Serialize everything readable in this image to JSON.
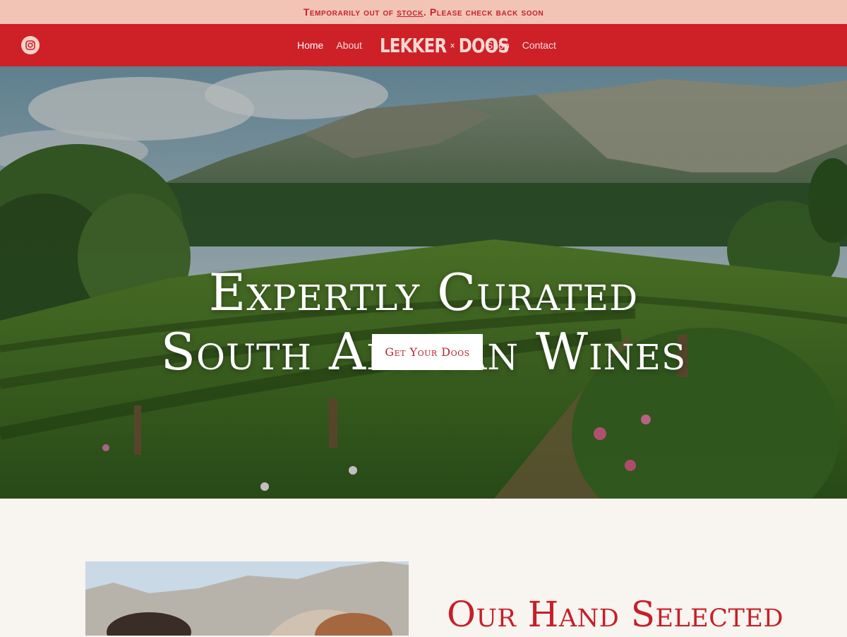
{
  "announcement": {
    "before_link": "Temporarily out of ",
    "link": "stock",
    "after_link": ". Please check back soon"
  },
  "header": {
    "social_icon": "instagram-icon",
    "nav_left": [
      "Home",
      "About"
    ],
    "nav_right": [
      "Shop",
      "Contact"
    ],
    "active": "Home",
    "logo_left": "LEKKER",
    "logo_sep": "×",
    "logo_right": "DOOS"
  },
  "hero": {
    "title_line1": "Expertly Curated",
    "title_line2": "South African Wines",
    "cta_label": "Get Your Doos"
  },
  "about": {
    "heading": "Our Hand Selected"
  },
  "colors": {
    "announcement_bg": "#f2c4b6",
    "brand_red": "#cd2027",
    "page_bg": "#f8f4f0"
  }
}
